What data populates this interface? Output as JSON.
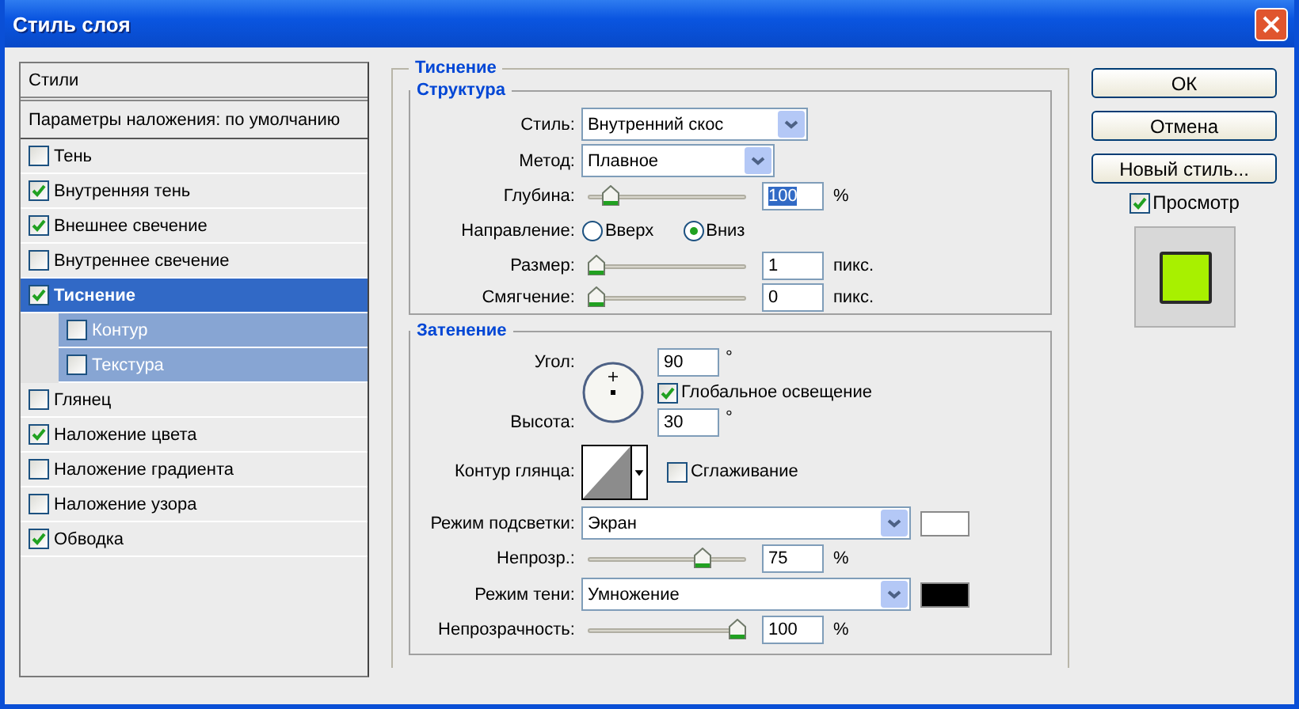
{
  "window": {
    "title": "Стиль слоя"
  },
  "styles_panel": {
    "header": "Стили",
    "blending_options": "Параметры наложения: по умолчанию",
    "items": [
      {
        "label": "Тень",
        "checked": false,
        "selected": false
      },
      {
        "label": "Внутренняя тень",
        "checked": true,
        "selected": false
      },
      {
        "label": "Внешнее свечение",
        "checked": true,
        "selected": false
      },
      {
        "label": "Внутреннее свечение",
        "checked": false,
        "selected": false
      },
      {
        "label": "Тиснение",
        "checked": true,
        "selected": true,
        "children": [
          {
            "label": "Контур",
            "checked": false,
            "selected": false
          },
          {
            "label": "Текстура",
            "checked": false,
            "selected": false
          }
        ]
      },
      {
        "label": "Глянец",
        "checked": false,
        "selected": false
      },
      {
        "label": "Наложение цвета",
        "checked": true,
        "selected": false
      },
      {
        "label": "Наложение градиента",
        "checked": false,
        "selected": false
      },
      {
        "label": "Наложение узора",
        "checked": false,
        "selected": false
      },
      {
        "label": "Обводка",
        "checked": true,
        "selected": false
      }
    ]
  },
  "bevel": {
    "title": "Тиснение",
    "structure": {
      "title": "Структура",
      "style": {
        "label": "Стиль:",
        "value": "Внутренний скос"
      },
      "technique": {
        "label": "Метод:",
        "value": "Плавное"
      },
      "depth": {
        "label": "Глубина:",
        "level": 0.1,
        "value": "100",
        "unit": "%",
        "value_selected": true
      },
      "direction": {
        "label": "Направление:",
        "options": [
          {
            "label": "Вверх",
            "selected": false
          },
          {
            "label": "Вниз",
            "selected": true
          }
        ]
      },
      "size": {
        "label": "Размер:",
        "level": 0,
        "value": "1",
        "unit": "пикс.",
        "value_selected": false
      },
      "soften": {
        "label": "Смягчение:",
        "level": 0,
        "value": "0",
        "unit": "пикс.",
        "value_selected": false
      }
    },
    "shading": {
      "title": "Затенение",
      "angle": {
        "label": "Угол:",
        "value": "90",
        "unit": "°"
      },
      "global_light": {
        "label": "Глобальное освещение",
        "checked": true
      },
      "altitude": {
        "label": "Высота:",
        "value": "30",
        "unit": "°"
      },
      "gloss_contour": {
        "label": "Контур глянца:"
      },
      "anti_aliased": {
        "label": "Сглаживание",
        "checked": false
      },
      "highlight_mode": {
        "label": "Режим подсветки:",
        "value": "Экран",
        "color": "#ffffff"
      },
      "highlight_opacity": {
        "label": "Непрозр.:",
        "level": 0.75,
        "value": "75",
        "unit": "%",
        "value_selected": false
      },
      "shadow_mode": {
        "label": "Режим тени:",
        "value": "Умножение",
        "color": "#000000"
      },
      "shadow_opacity": {
        "label": "Непрозрачность:",
        "level": 1,
        "value": "100",
        "unit": "%",
        "value_selected": false
      }
    }
  },
  "buttons": [
    "ОК",
    "Отмена",
    "Новый стиль..."
  ],
  "preview": {
    "label": "Просмотр",
    "checked": true
  }
}
